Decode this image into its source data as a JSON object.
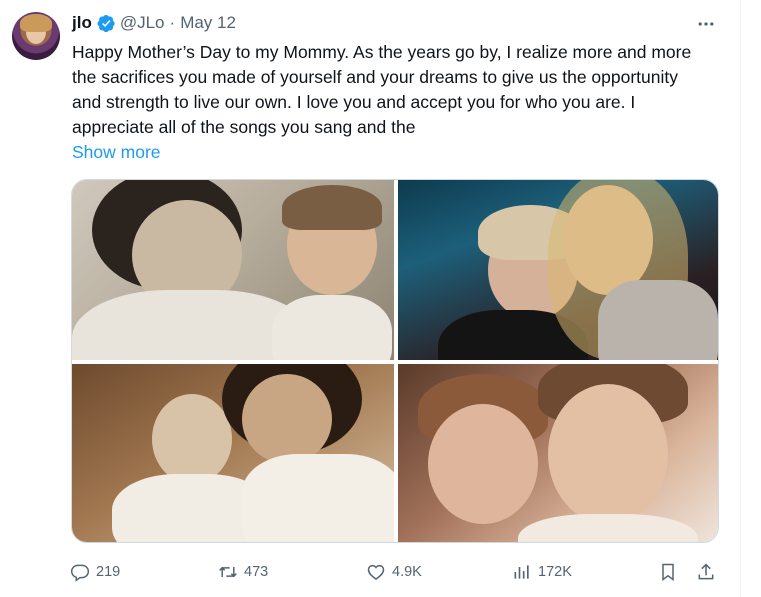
{
  "tweet": {
    "author_name": "jlo",
    "handle": "@JLo",
    "separator": "·",
    "date": "May 12",
    "text": "Happy Mother’s Day to my Mommy. As the years go by, I realize more and more the sacrifices you made of yourself and your dreams to give us the opportunity and strength to live our own. I love you and accept you for who you are. I appreciate all of the songs you sang and the",
    "show_more": "Show more"
  },
  "actions": {
    "replies": "219",
    "retweets": "473",
    "likes": "4.9K",
    "views": "172K"
  },
  "icons": [
    "verified-badge-icon",
    "more-icon",
    "reply-icon",
    "retweet-icon",
    "like-icon",
    "views-icon",
    "bookmark-icon",
    "share-icon"
  ],
  "colors": {
    "accent": "#1d9bf0",
    "text": "#0f1419",
    "secondary": "#536471"
  }
}
